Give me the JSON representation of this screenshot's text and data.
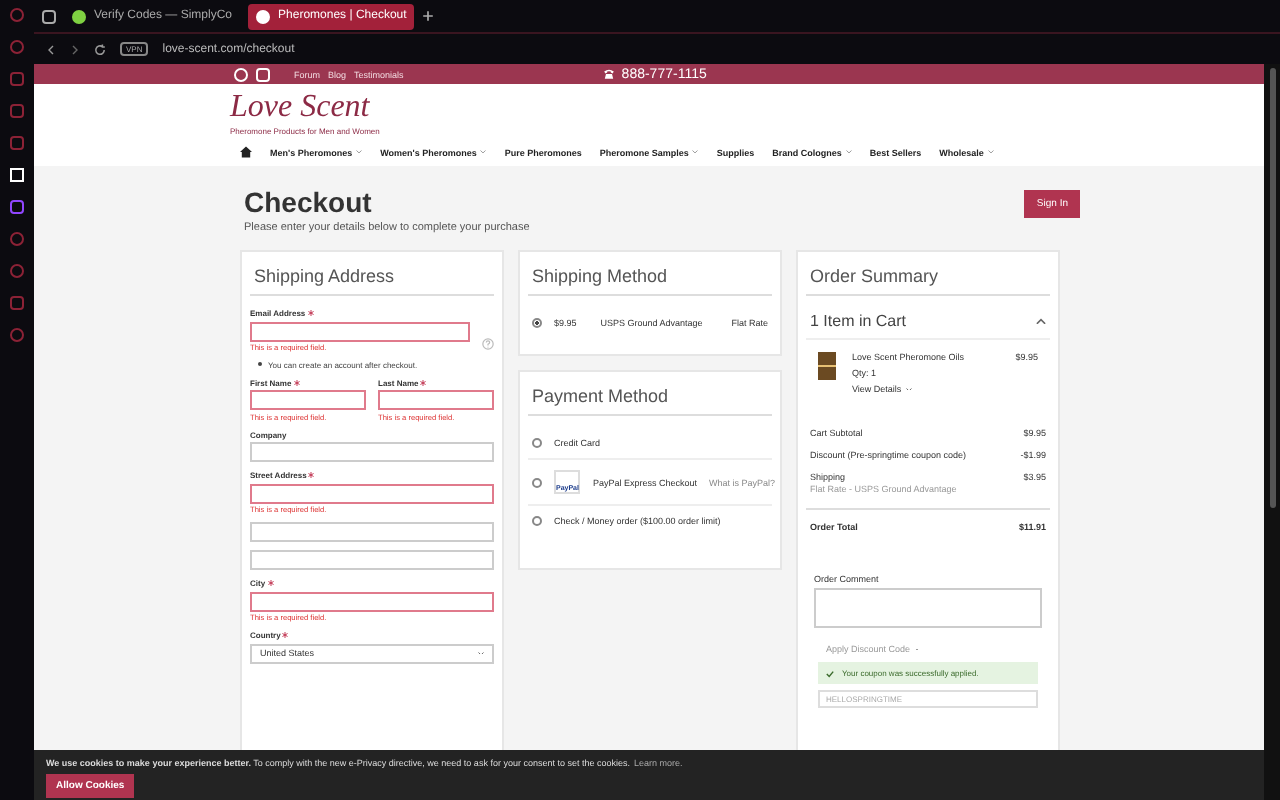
{
  "browser": {
    "tabs": [
      {
        "title": "Verify Codes — SimplyCo",
        "selected": false
      },
      {
        "title": "Pheromones | Checkout",
        "selected": true
      }
    ],
    "vpn": "VPN",
    "address": "love-scent.com/checkout"
  },
  "site": {
    "top_links": [
      "Forum",
      "Blog",
      "Testimonials"
    ],
    "phone": "888-777-1115",
    "logo": {
      "name": "Love Scent",
      "tagline": "Pheromone Products for Men and Women"
    },
    "nav": [
      {
        "label": "Men's Pheromones",
        "dropdown": true
      },
      {
        "label": "Women's Pheromones",
        "dropdown": true
      },
      {
        "label": "Pure Pheromones",
        "dropdown": false
      },
      {
        "label": "Pheromone Samples",
        "dropdown": true
      },
      {
        "label": "Supplies",
        "dropdown": false
      },
      {
        "label": "Brand Colognes",
        "dropdown": true
      },
      {
        "label": "Best Sellers",
        "dropdown": false
      },
      {
        "label": "Wholesale",
        "dropdown": true
      }
    ]
  },
  "checkout": {
    "title": "Checkout",
    "subtitle": "Please enter your details below to complete your purchase",
    "sign_in": "Sign In"
  },
  "shipping_address": {
    "title": "Shipping Address",
    "rows": [
      [
        {
          "kind": "text",
          "label": "Email Address",
          "required": true,
          "error": "This is a required field.",
          "help": true,
          "note": "You can create an account after checkout."
        }
      ],
      [
        {
          "kind": "text",
          "label": "First Name",
          "required": true,
          "error": "This is a required field."
        },
        {
          "kind": "text",
          "label": "Last Name",
          "required": true,
          "error": "This is a required field."
        }
      ],
      [
        {
          "kind": "text",
          "label": "Company",
          "required": false
        }
      ],
      [
        {
          "kind": "text",
          "label": "Street Address",
          "required": true,
          "error": "This is a required field."
        }
      ],
      [
        {
          "kind": "text",
          "required": false
        }
      ],
      [
        {
          "kind": "text",
          "required": false
        }
      ],
      [
        {
          "kind": "text",
          "label": "City",
          "required": true,
          "error": "This is a required field."
        }
      ],
      [
        {
          "kind": "select",
          "label": "Country",
          "required": true,
          "value": "United States"
        }
      ]
    ]
  },
  "shipping_method": {
    "title": "Shipping Method",
    "options": [
      {
        "price": "$9.95",
        "carrier": "USPS Ground Advantage",
        "type": "Flat Rate",
        "selected": true
      }
    ]
  },
  "payment_method": {
    "title": "Payment Method",
    "options": [
      {
        "label": "Credit Card",
        "selected": false
      },
      {
        "label": "PayPal Express Checkout",
        "logo": "PayPal",
        "link": "What is PayPal?",
        "selected": false
      },
      {
        "label": "Check / Money order ($100.00 order limit)",
        "selected": false
      }
    ]
  },
  "order_summary": {
    "title": "Order Summary",
    "cart_title": "1 Item in Cart",
    "expanded": true,
    "item": {
      "name": "Love Scent Pheromone Oils",
      "qty": "Qty: 1",
      "price": "$9.95",
      "details": "View Details"
    },
    "totals": [
      {
        "label": "Cart Subtotal",
        "value": "$9.95"
      },
      {
        "label": "Discount (Pre-springtime coupon code)",
        "value": "-$1.99"
      },
      {
        "label": "Shipping",
        "sub": "Flat Rate - USPS Ground Advantage",
        "value": "$3.95"
      }
    ],
    "order_total": {
      "label": "Order Total",
      "value": "$11.91"
    },
    "comment_label": "Order Comment",
    "discount_toggle": "Apply Discount Code",
    "success": "Your coupon was successfully applied.",
    "coupon": "HELLOSPRINGTIME"
  },
  "cookie": {
    "text": "**We use cookies to make your experience better.** To comply with the new e-Privacy directive, we need to ask for your consent to set the cookies.",
    "link": "Learn more.",
    "button": "Allow Cookies"
  }
}
